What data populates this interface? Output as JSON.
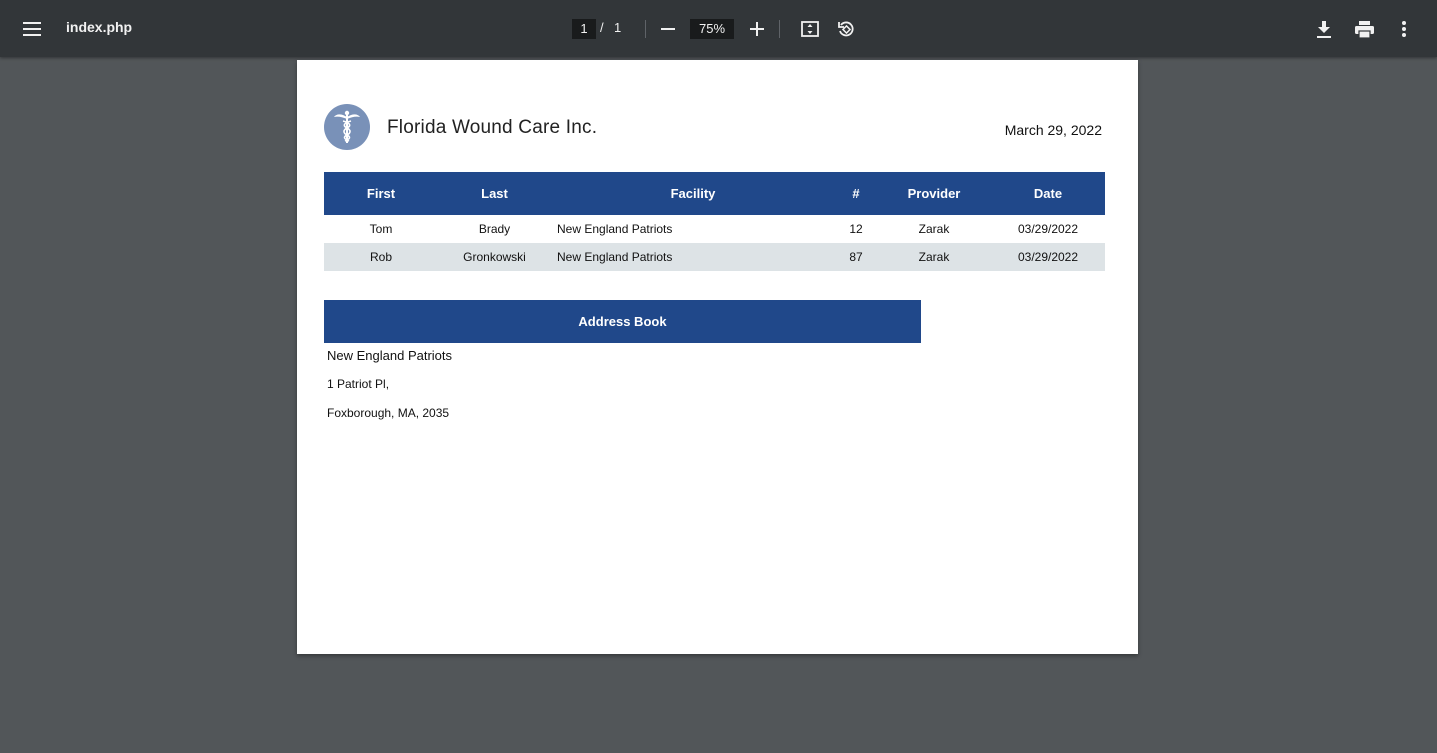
{
  "toolbar": {
    "title": "index.php",
    "page_current": "1",
    "page_separator": "/",
    "page_total": "1",
    "zoom": "75%",
    "icons": [
      "menu-icon",
      "minus-icon",
      "plus-icon",
      "fit-page-icon",
      "rotate-icon",
      "download-icon",
      "print-icon",
      "more-vert-icon"
    ]
  },
  "document": {
    "company": "Florida Wound Care Inc.",
    "date": "March 29, 2022",
    "logo_icon": "caduceus-icon",
    "table": {
      "headers": [
        "First",
        "Last",
        "Facility",
        "#",
        "Provider",
        "Date"
      ],
      "rows": [
        [
          "Tom",
          "Brady",
          "New England Patriots",
          "12",
          "Zarak",
          "03/29/2022"
        ],
        [
          "Rob",
          "Gronkowski",
          "New England Patriots",
          "87",
          "Zarak",
          "03/29/2022"
        ]
      ]
    },
    "address_book": {
      "header": "Address Book",
      "name": "New England Patriots",
      "street": "1 Patriot Pl,",
      "city": "Foxborough, MA, 2035"
    }
  },
  "colors": {
    "toolbar_bg": "#323639",
    "viewer_bg": "#525659",
    "header_blue": "#20488a",
    "row_alt": "#dde3e6",
    "logo_bg": "#7991b8"
  }
}
